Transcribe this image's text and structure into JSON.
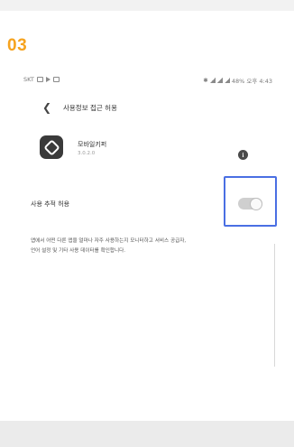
{
  "step": {
    "number": "03"
  },
  "status_bar": {
    "carrier": "SKT",
    "right_text": "48% 오후 4:43"
  },
  "header": {
    "title": "사용정보 접근 허용"
  },
  "app": {
    "name": "모바일키퍼",
    "version": "3.0.2.0"
  },
  "setting": {
    "label": "사용 추적 허용",
    "toggle_state": "on"
  },
  "description": {
    "lines": [
      "앱에서 어떤 다른 앱을 얼마나 자주 사용하는지 모니터하고 서비스 공급자,",
      "언어 설정 및 기타 사용 데이터를 확인합니다."
    ]
  },
  "colors": {
    "step_number": "#f6a31e",
    "highlight_border": "#4a6fe3",
    "toggle_track": "#cfcfcf"
  },
  "icons": {
    "back": "back-arrow-icon",
    "app": "mobile-keeper-app-icon",
    "info": "info-icon"
  }
}
